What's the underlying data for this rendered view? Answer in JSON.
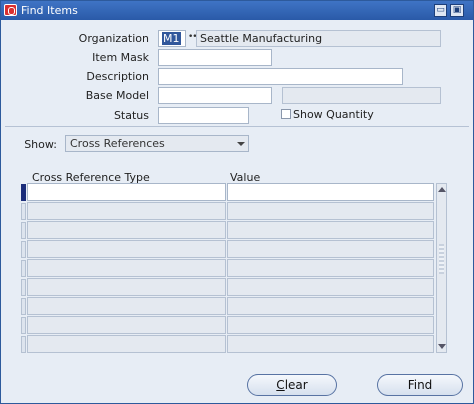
{
  "window": {
    "title": "Find Items"
  },
  "form": {
    "organization_label": "Organization",
    "organization_code": "M1",
    "organization_name": "Seattle Manufacturing",
    "item_mask_label": "Item Mask",
    "item_mask_value": "",
    "description_label": "Description",
    "description_value": "",
    "base_model_label": "Base Model",
    "base_model_value": "",
    "base_model_desc": "",
    "status_label": "Status",
    "status_value": "",
    "show_quantity_label": "Show Quantity"
  },
  "show": {
    "label": "Show:",
    "selected": "Cross References"
  },
  "grid": {
    "columns": [
      "Cross Reference Type",
      "Value"
    ],
    "rows": [
      [
        "",
        ""
      ],
      [
        "",
        ""
      ],
      [
        "",
        ""
      ],
      [
        "",
        ""
      ],
      [
        "",
        ""
      ],
      [
        "",
        ""
      ],
      [
        "",
        ""
      ],
      [
        "",
        ""
      ],
      [
        "",
        ""
      ]
    ]
  },
  "buttons": {
    "clear_mnemonic": "C",
    "clear_rest": "lear",
    "find": "Find"
  }
}
